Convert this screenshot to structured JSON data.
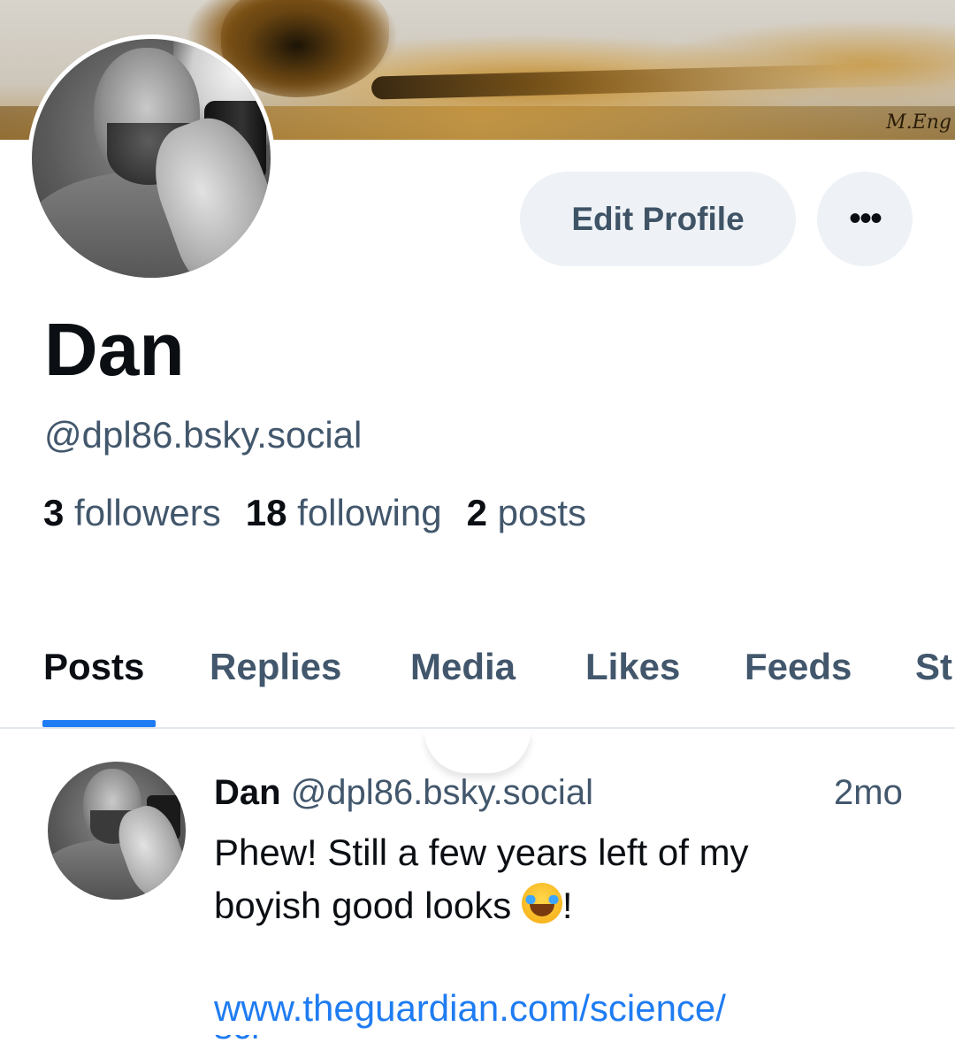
{
  "profile": {
    "display_name": "Dan",
    "handle": "@dpl86.bsky.social",
    "banner_signature": "M.Eng",
    "edit_profile_label": "Edit Profile",
    "more_label": "•••",
    "stats": {
      "followers_count": "3",
      "followers_label": "followers",
      "following_count": "18",
      "following_label": "following",
      "posts_count": "2",
      "posts_label": "posts"
    }
  },
  "tabs": [
    {
      "label": "Posts",
      "active": true
    },
    {
      "label": "Replies",
      "active": false
    },
    {
      "label": "Media",
      "active": false
    },
    {
      "label": "Likes",
      "active": false
    },
    {
      "label": "Feeds",
      "active": false
    },
    {
      "label": "St",
      "active": false
    }
  ],
  "post": {
    "author": "Dan",
    "handle": "@dpl86.bsky.social",
    "time": "2mo",
    "text_line1": "Phew! Still a few years left of my",
    "text_line2_before": "boyish good looks ",
    "emoji_name": "face-with-tears-of-joy",
    "text_line2_after": "!",
    "link": "www.theguardian.com/science/",
    "link_cut": "sci"
  },
  "colors": {
    "accent": "#1f7cf2",
    "text_primary": "#0b0f14",
    "text_secondary": "#42576c",
    "button_bg": "#eef2f6"
  }
}
